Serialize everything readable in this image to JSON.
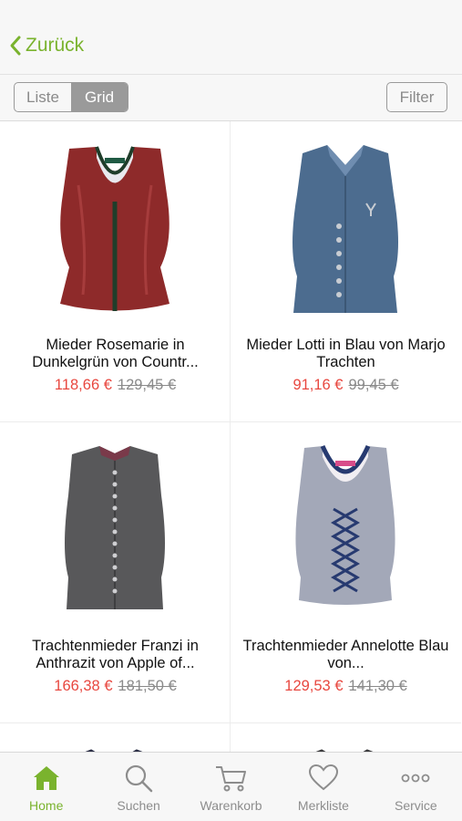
{
  "nav": {
    "back_label": "Zurück"
  },
  "view_toggle": {
    "options": [
      "Liste",
      "Grid"
    ],
    "selected": "Grid"
  },
  "filter_label": "Filter",
  "products": [
    {
      "name": "Mieder Rosemarie in Dunkelgrün von Countr...",
      "price": "118,66 €",
      "old_price": "129,45 €"
    },
    {
      "name": "Mieder Lotti in Blau von Marjo Trachten",
      "price": "91,16 €",
      "old_price": "99,45 €"
    },
    {
      "name": "Trachtenmieder Franzi in Anthrazit von Apple of...",
      "price": "166,38 €",
      "old_price": "181,50 €"
    },
    {
      "name": "Trachtenmieder Annelotte Blau von...",
      "price": "129,53 €",
      "old_price": "141,30 €"
    }
  ],
  "tabbar": {
    "items": [
      {
        "label": "Home",
        "icon": "home-icon",
        "active": true
      },
      {
        "label": "Suchen",
        "icon": "search-icon",
        "active": false
      },
      {
        "label": "Warenkorb",
        "icon": "cart-icon",
        "active": false
      },
      {
        "label": "Merkliste",
        "icon": "heart-icon",
        "active": false
      },
      {
        "label": "Service",
        "icon": "more-icon",
        "active": false
      }
    ]
  },
  "colors": {
    "accent": "#7ab32e",
    "sale": "#e8473f",
    "muted": "#8d8d8d"
  }
}
